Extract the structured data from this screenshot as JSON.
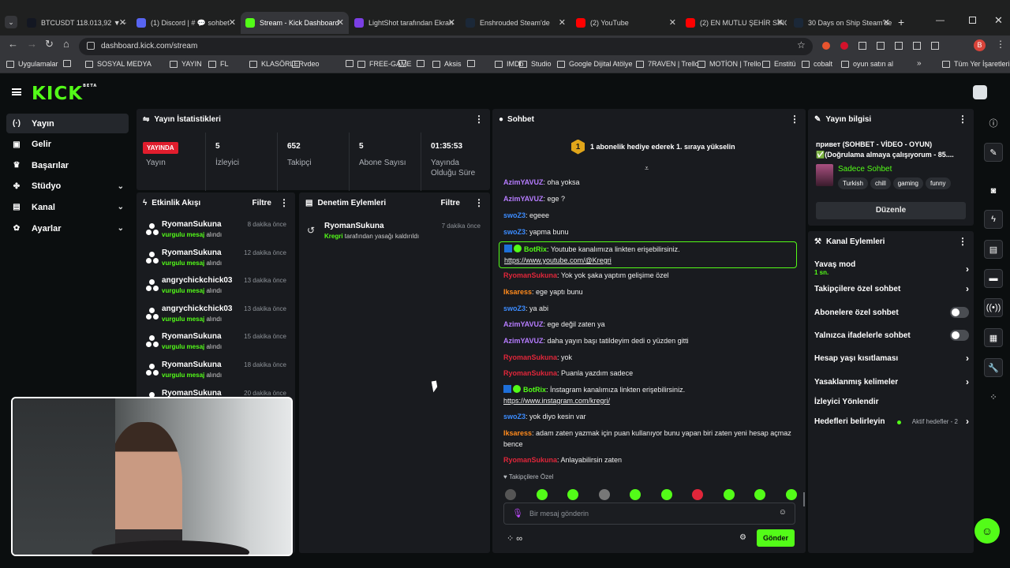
{
  "browser": {
    "tabs": [
      {
        "title": "BTCUSDT 118.013,92 ▼ −",
        "color": "#131722"
      },
      {
        "title": "(1) Discord | # 💬 sohbet",
        "color": "#5865f2"
      },
      {
        "title": "Stream - Kick Dashboard",
        "color": "#53fc18"
      },
      {
        "title": "LightShot tarafından Ekran",
        "color": "#7b3fe4"
      },
      {
        "title": "Enshrouded Steam'de",
        "color": "#1b2838"
      },
      {
        "title": "(2) YouTube",
        "color": "#ff0000"
      },
      {
        "title": "(2) EN MUTLU ŞEHİR SİNOP",
        "color": "#ff0000"
      },
      {
        "title": "30 Days on Ship Steam'de",
        "color": "#1b2838"
      }
    ],
    "url": "dashboard.kick.com/stream",
    "bookmarks": [
      "Uygulamalar",
      "",
      "SOSYAL MEDYA",
      "YAYIN",
      "FL",
      "KLASÖRLER",
      "vdeo",
      "",
      "FREE-GAME",
      "",
      "",
      "Aksis",
      "",
      "IMDb",
      "Studio",
      "Google Dijital Atölye",
      "7RAVEN | Trello",
      "MOTİON | Trello",
      "Enstitü",
      "cobalt",
      "oyun satın al"
    ],
    "bookmarks_right": "Tüm Yer İşaretleri",
    "avatar_letter": "B"
  },
  "app": {
    "logo": "KICK",
    "logo_beta": "BETA"
  },
  "sidebar": [
    {
      "label": "Yayın",
      "icon": "broadcast-icon",
      "active": true
    },
    {
      "label": "Gelir",
      "icon": "revenue-icon"
    },
    {
      "label": "Başarılar",
      "icon": "trophy-icon"
    },
    {
      "label": "Stüdyo",
      "icon": "studio-icon",
      "chev": true
    },
    {
      "label": "Kanal",
      "icon": "channel-icon",
      "chev": true
    },
    {
      "label": "Ayarlar",
      "icon": "gear-icon",
      "chev": true
    }
  ],
  "stats": {
    "title": "Yayın İstatistikleri",
    "live": "YAYINDA",
    "status_label": "Yayın",
    "items": [
      {
        "value": "5",
        "label": "İzleyici"
      },
      {
        "value": "652",
        "label": "Takipçi"
      },
      {
        "value": "5",
        "label": "Abone Sayısı"
      },
      {
        "value": "01:35:53",
        "label": "Yayında Olduğu Süre"
      }
    ]
  },
  "activity": {
    "title": "Etkinlik Akışı",
    "filter": "Filtre",
    "items": [
      {
        "name": "RyomanSukuna",
        "hl": "vurgulu mesaj",
        "rest": " alındı",
        "time": "8 dakika önce"
      },
      {
        "name": "RyomanSukuna",
        "hl": "vurgulu mesaj",
        "rest": " alındı",
        "time": "12 dakika önce"
      },
      {
        "name": "angrychickchick03",
        "hl": "vurgulu mesaj",
        "rest": " alındı",
        "time": "13 dakika önce"
      },
      {
        "name": "angrychickchick03",
        "hl": "vurgulu mesaj",
        "rest": " alındı",
        "time": "13 dakika önce"
      },
      {
        "name": "RyomanSukuna",
        "hl": "vurgulu mesaj",
        "rest": " alındı",
        "time": "15 dakika önce"
      },
      {
        "name": "RyomanSukuna",
        "hl": "vurgulu mesaj",
        "rest": " alındı",
        "time": "18 dakika önce"
      },
      {
        "name": "RyomanSukuna",
        "hl": "",
        "rest": "",
        "time": "20 dakika önce"
      }
    ]
  },
  "moderation": {
    "title": "Denetim Eylemleri",
    "filter": "Filtre",
    "item": {
      "name": "RyomanSukuna",
      "actor": "Kregri",
      "text": " tarafından yasağı kaldırıldı",
      "time": "7 dakika önce"
    }
  },
  "chat": {
    "title": "Sohbet",
    "banner_num": "1",
    "banner": "1 abonelik hediye ederek 1. sıraya yükselin",
    "lines": [
      {
        "user": "AzimYAVUZ",
        "color": "#b67cff",
        "text": ": oha yoksa"
      },
      {
        "user": "AzimYAVUZ",
        "color": "#b67cff",
        "text": ": ege ?"
      },
      {
        "user": "swoZ3",
        "color": "#3c8cff",
        "text": ": egeee"
      },
      {
        "user": "swoZ3",
        "color": "#3c8cff",
        "text": ": yapma bunu"
      },
      {
        "user": "BotRix",
        "color": "#53fc18",
        "text": ": Youtube kanalımıza linkten erişebilirsiniz.",
        "link": "https://www.youtube.com/@Kregri",
        "boxed": true
      },
      {
        "user": "RyomanSukuna",
        "color": "#e0263a",
        "text": ": Yok yok şaka yaptım gelişime özel"
      },
      {
        "user": "Iksaress",
        "color": "#ff8a1c",
        "text": ": ege yaptı bunu"
      },
      {
        "user": "swoZ3",
        "color": "#3c8cff",
        "text": ": ya abi"
      },
      {
        "user": "AzimYAVUZ",
        "color": "#b67cff",
        "text": ": ege değil zaten ya"
      },
      {
        "user": "AzimYAVUZ",
        "color": "#b67cff",
        "text": ": daha yayın başı tatildeyim dedi o yüzden gitti"
      },
      {
        "user": "RyomanSukuna",
        "color": "#e0263a",
        "text": ": yok"
      },
      {
        "user": "RyomanSukuna",
        "color": "#e0263a",
        "text": ": Puanla yazdım sadece"
      },
      {
        "user": "BotRix",
        "color": "#53fc18",
        "text": ": İnstagram kanalımıza linkten erişebilirsiniz.",
        "link": "https://www.instagram.com/kregri/"
      },
      {
        "user": "swoZ3",
        "color": "#3c8cff",
        "text": ": yok diyo kesin var"
      },
      {
        "user": "Iksaress",
        "color": "#ff8a1c",
        "text": ": adam zaten yazmak için puan kullanıyor bunu yapan biri zaten yeni hesap açmaz bence"
      },
      {
        "user": "RyomanSukuna",
        "color": "#e0263a",
        "text": ": Anlayabilirsin zaten"
      }
    ],
    "followers_only": "Takipçilere Özel",
    "input_placeholder": "Bir mesaj gönderin",
    "send": "Gönder"
  },
  "stream_info": {
    "title": "Yayın bilgisi",
    "stream_title": "привет (SOHBET - VİDEO - OYUN)",
    "stream_title2": "✅(Doğrulama almaya çalışıyorum - 85....",
    "category": "Sadece Sohbet",
    "tags": [
      "Turkish",
      "chill",
      "gaming",
      "funny"
    ],
    "edit": "Düzenle"
  },
  "channel_actions": {
    "title": "Kanal Eylemleri",
    "items": [
      {
        "label": "Yavaş mod",
        "sub": "1 sn.",
        "ctrl": "arrow"
      },
      {
        "label": "Takipçilere özel sohbet",
        "ctrl": "arrow"
      },
      {
        "label": "Abonelere özel sohbet",
        "ctrl": "toggle"
      },
      {
        "label": "Yalnızca ifadelerle sohbet",
        "ctrl": "toggle"
      },
      {
        "label": "Hesap yaşı kısıtlaması",
        "ctrl": "arrow"
      },
      {
        "label": "Yasaklanmış kelimeler",
        "ctrl": "arrow"
      },
      {
        "label": "İzleyici Yönlendir",
        "ctrl": "none"
      },
      {
        "label": "Hedefleri belirleyin",
        "ctrl": "arrow",
        "extra": "Aktif hedefler - 2"
      }
    ]
  },
  "colors": {
    "accent": "#53fc18",
    "live": "#e11d2d",
    "panel": "#191b1f",
    "bg": "#0b0e0f"
  }
}
